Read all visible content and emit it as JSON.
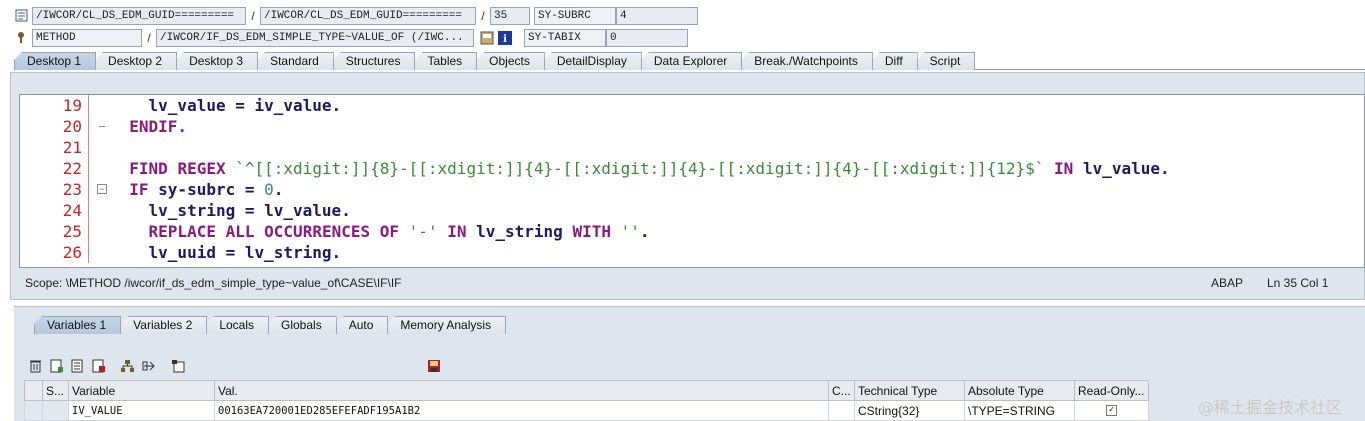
{
  "header": {
    "row1": {
      "program": "/IWCOR/CL_DS_EDM_GUID=========",
      "include": "/IWCOR/CL_DS_EDM_GUID=========",
      "line": "35",
      "sysfield_label": "SY-SUBRC",
      "sysfield_value": "4"
    },
    "row2": {
      "event_type": "METHOD",
      "event": "/IWCOR/IF_DS_EDM_SIMPLE_TYPE~VALUE_OF (/IWC...",
      "sysfield_label": "SY-TABIX",
      "sysfield_value": "0"
    }
  },
  "desktop_tabs": [
    "Desktop 1",
    "Desktop 2",
    "Desktop 3",
    "Standard",
    "Structures",
    "Tables",
    "Objects",
    "DetailDisplay",
    "Data Explorer",
    "Break./Watchpoints",
    "Diff",
    "Script"
  ],
  "code_lines": [
    {
      "n": "19",
      "text": "    lv_value = iv_value."
    },
    {
      "n": "20",
      "text": "  ENDIF."
    },
    {
      "n": "21",
      "text": ""
    },
    {
      "n": "22",
      "text": "  FIND REGEX `^[[:xdigit:]]{8}-[[:xdigit:]]{4}-[[:xdigit:]]{4}-[[:xdigit:]]{4}-[[:xdigit:]]{12}$` IN lv_value."
    },
    {
      "n": "23",
      "text": "  IF sy-subrc = 0."
    },
    {
      "n": "24",
      "text": "    lv_string = lv_value."
    },
    {
      "n": "25",
      "text": "    REPLACE ALL OCCURRENCES OF '-' IN lv_string WITH ''."
    },
    {
      "n": "26",
      "text": "    lv_uuid = lv_string."
    }
  ],
  "status": {
    "scope": "Scope: \\METHOD /iwcor/if_ds_edm_simple_type~value_of\\CASE\\IF\\IF",
    "language": "ABAP",
    "position": "Ln  35 Col   1"
  },
  "variable_tabs": [
    "Variables 1",
    "Variables 2",
    "Locals",
    "Globals",
    "Auto",
    "Memory Analysis"
  ],
  "table": {
    "headers": [
      "S...",
      "Variable",
      "Val.",
      "C...",
      "Technical Type",
      "Absolute Type",
      "Read-Only..."
    ],
    "rows": [
      {
        "variable": "IV_VALUE",
        "value": "00163EA720001ED285EFEFADF195A1B2",
        "technical_type": "CString{32}",
        "absolute_type": "\\TYPE=STRING",
        "read_only": true
      }
    ]
  },
  "watermark": "@稀土掘金技术社区"
}
